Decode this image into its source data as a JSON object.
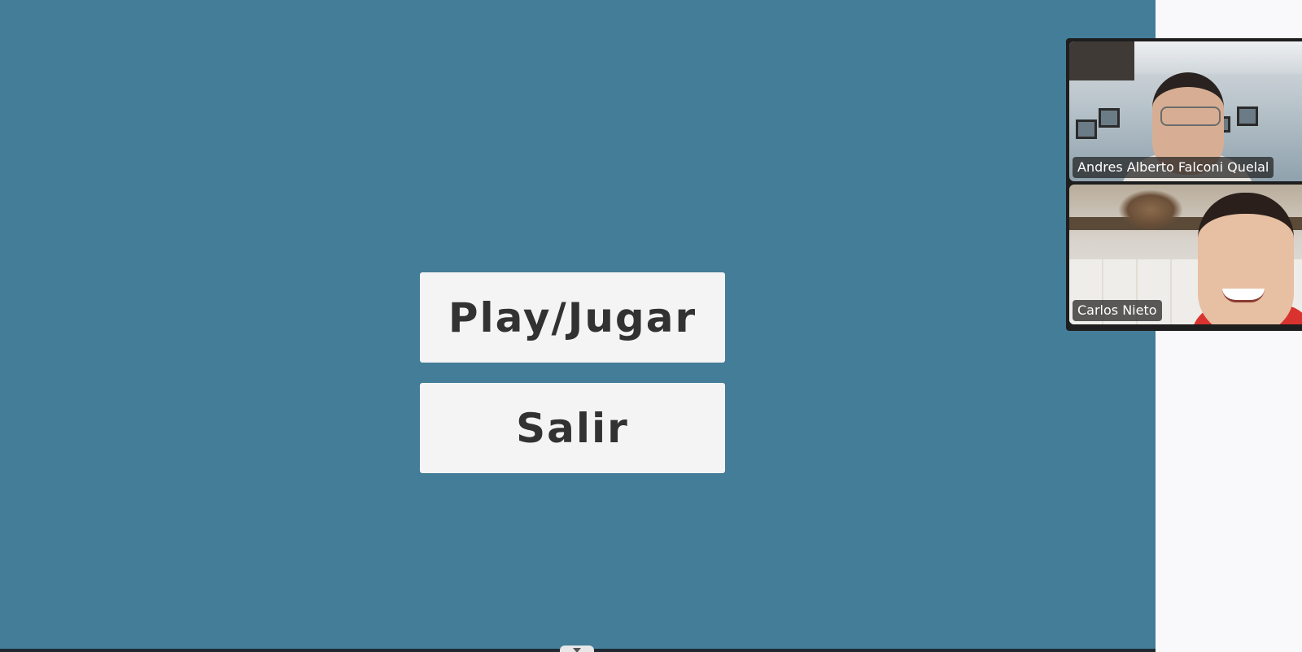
{
  "menu": {
    "play_label": "Play/Jugar",
    "exit_label": "Salir"
  },
  "video_call": {
    "participants": [
      {
        "name": "Andres Alberto Falconi Quelal"
      },
      {
        "name": "Carlos Nieto"
      }
    ]
  },
  "colors": {
    "game_background": "#437d98",
    "button_background": "#f4f4f4",
    "button_text": "#323232",
    "side_panel": "#f9f9fb"
  }
}
